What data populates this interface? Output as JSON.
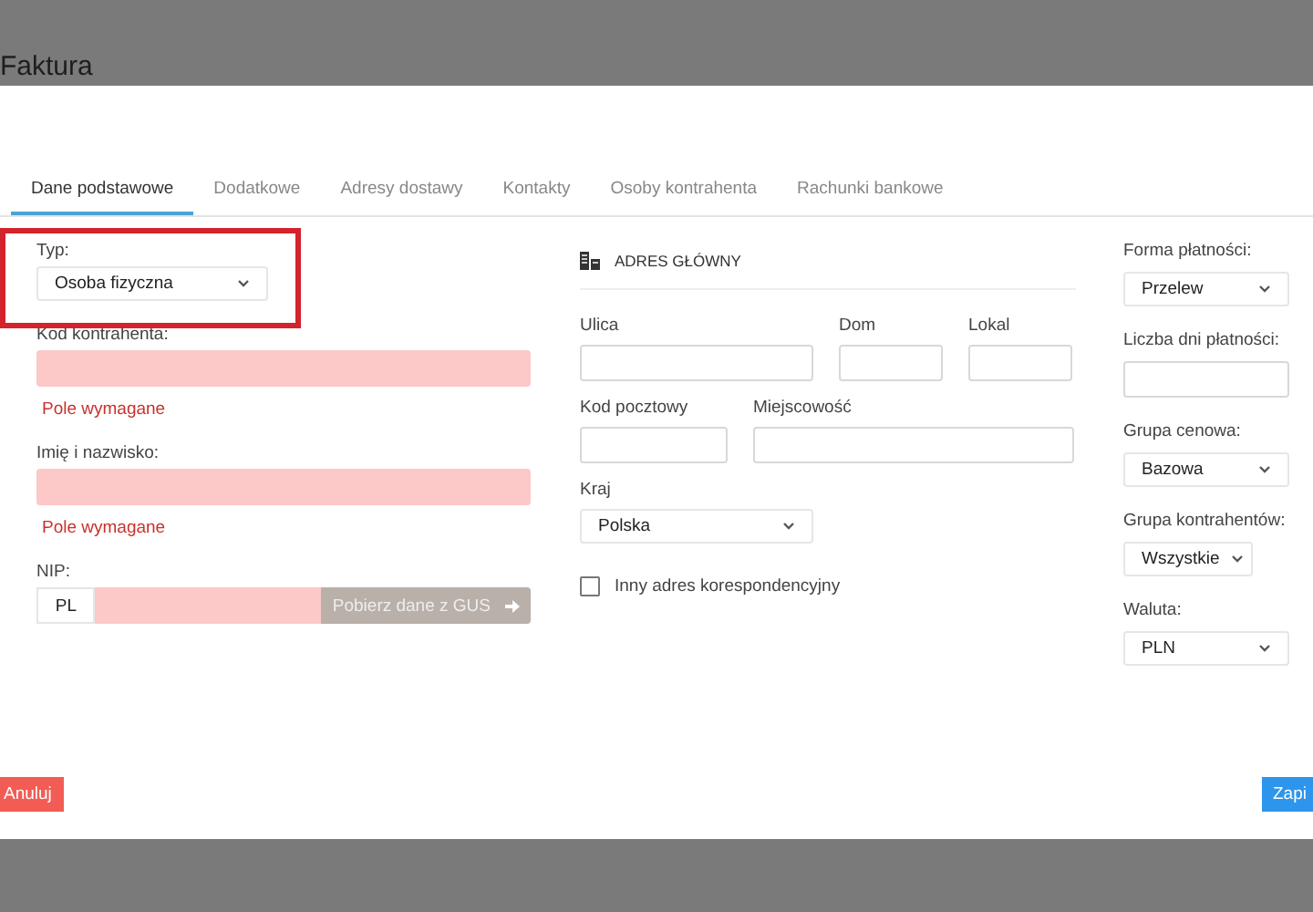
{
  "background": {
    "title": "Faktura"
  },
  "tabs": [
    {
      "label": "Dane podstawowe",
      "selected": true
    },
    {
      "label": "Dodatkowe",
      "selected": false
    },
    {
      "label": "Adresy dostawy",
      "selected": false
    },
    {
      "label": "Kontakty",
      "selected": false
    },
    {
      "label": "Osoby kontrahenta",
      "selected": false
    },
    {
      "label": "Rachunki bankowe",
      "selected": false
    }
  ],
  "left_fields": [
    {
      "kind": "select",
      "label": "Typ:",
      "value": "Osoba fizyczna",
      "highlighted": true
    },
    {
      "kind": "text",
      "label": "Kod kontrahenta:",
      "invalid": true,
      "error": "Pole wymagane"
    },
    {
      "kind": "text",
      "label": "Imię i nazwisko:",
      "invalid": true,
      "error": "Pole wymagane"
    },
    {
      "kind": "nip",
      "label": "NIP:",
      "prefix": "PL",
      "invalid": true,
      "button": "Pobierz dane z GUS",
      "disabled": true
    }
  ],
  "address": {
    "title": "ADRES GŁÓWNY",
    "rows": [
      [
        {
          "kind": "text",
          "label": "Ulica"
        },
        {
          "kind": "text",
          "label": "Dom"
        },
        {
          "kind": "text",
          "label": "Lokal"
        }
      ],
      [
        {
          "kind": "text",
          "label": "Kod pocztowy"
        },
        {
          "kind": "text",
          "label": "Miejscowość"
        }
      ],
      [
        {
          "kind": "select",
          "label": "Kraj",
          "value": "Polska"
        }
      ]
    ],
    "checkbox": {
      "label": "Inny adres korespondencyjny",
      "checked": false
    }
  },
  "right_fields": [
    {
      "kind": "select",
      "label": "Forma płatności:",
      "value": "Przelew"
    },
    {
      "kind": "text",
      "label": "Liczba dni płatności:"
    },
    {
      "kind": "select",
      "label": "Grupa cenowa:",
      "value": "Bazowa"
    },
    {
      "kind": "select",
      "label": "Grupa kontrahentów:",
      "value": "Wszystkie"
    },
    {
      "kind": "select",
      "label": "Waluta:",
      "value": "PLN"
    }
  ],
  "buttons": [
    {
      "kind": "cancel",
      "label": "Anuluj"
    },
    {
      "kind": "save",
      "label": "Zapi"
    }
  ]
}
